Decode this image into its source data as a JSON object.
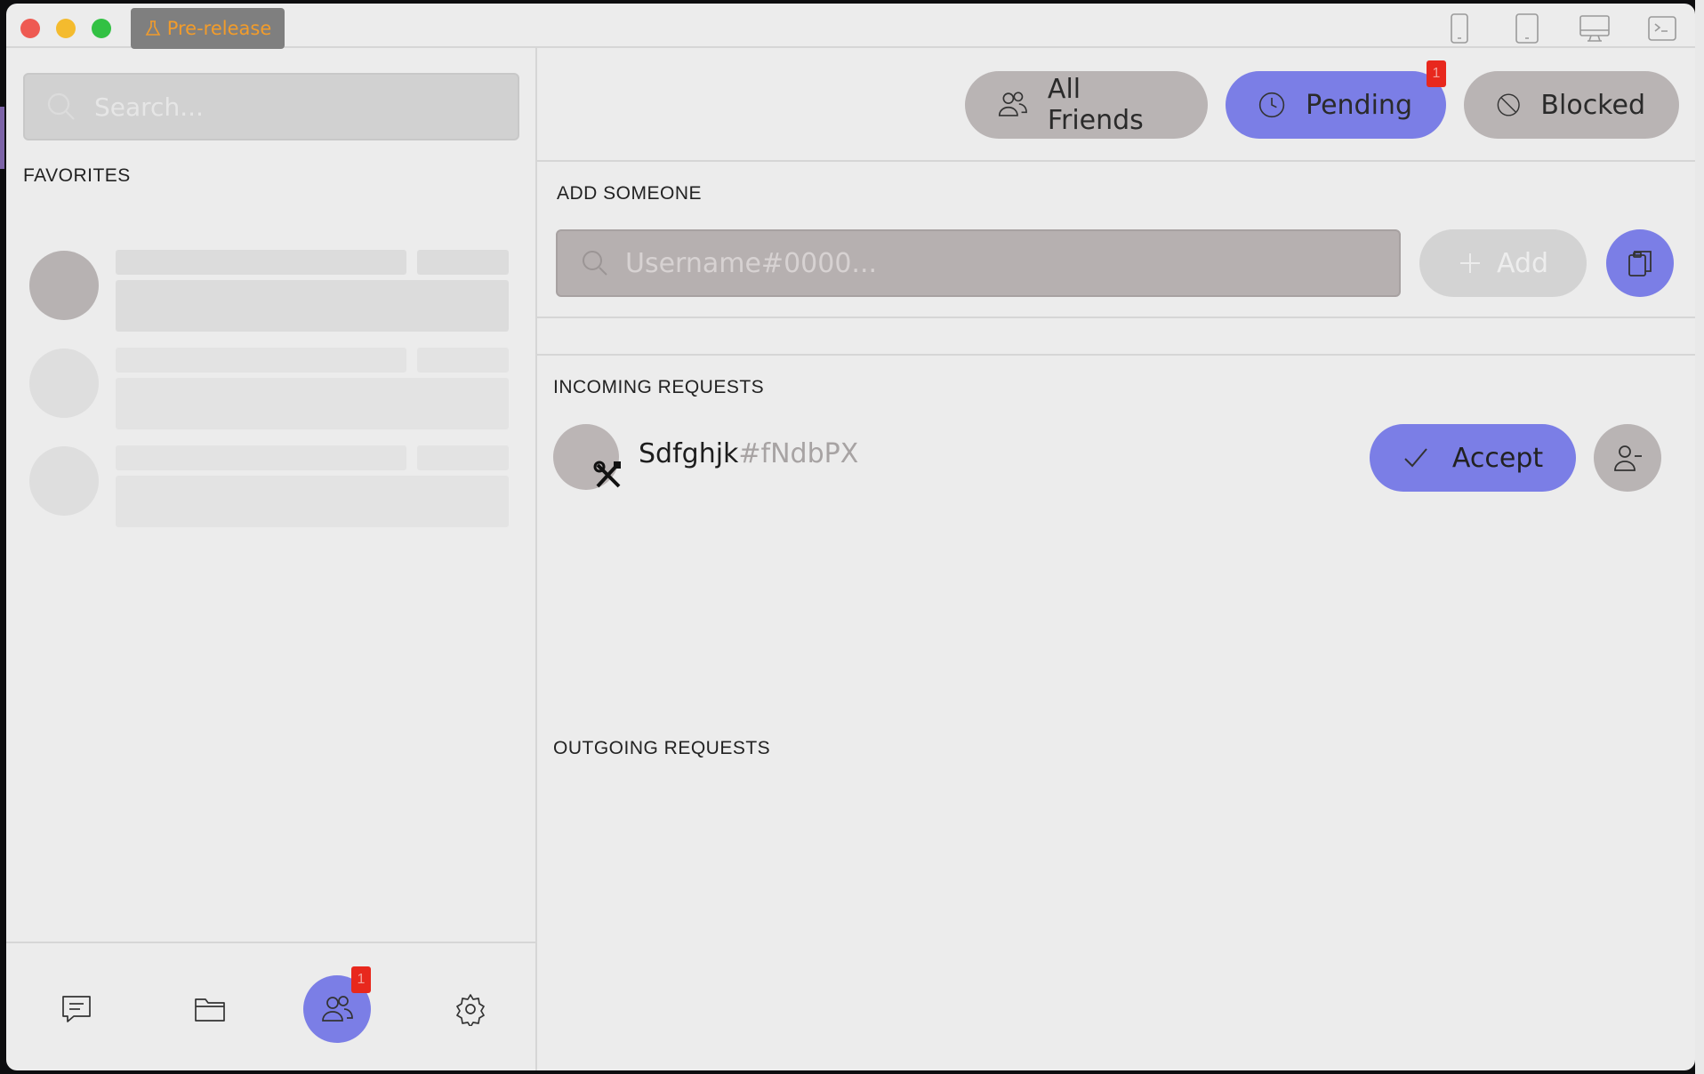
{
  "titlebar": {
    "badge_label": "Pre-release",
    "view_icons": [
      "mobile-icon",
      "tablet-icon",
      "desktop-icon",
      "terminal-icon"
    ]
  },
  "sidebar": {
    "search_placeholder": "Search...",
    "favorites_title": "FAVORITES",
    "nav": {
      "items": [
        "chat-icon",
        "folder-icon",
        "friends-icon",
        "settings-icon"
      ],
      "active": "friends-icon",
      "friends_badge": "1"
    }
  },
  "main": {
    "tabs": [
      {
        "label": "All Friends",
        "icon": "users-icon",
        "active": false
      },
      {
        "label": "Pending",
        "icon": "clock-icon",
        "active": true,
        "badge": "1"
      },
      {
        "label": "Blocked",
        "icon": "blocked-icon",
        "active": false
      }
    ],
    "add_someone": {
      "title": "ADD SOMEONE",
      "placeholder": "Username#0000...",
      "add_label": "Add"
    },
    "incoming": {
      "title": "INCOMING REQUESTS",
      "requests": [
        {
          "name": "Sdfghjk",
          "tag": "#fNdbPX",
          "accept_label": "Accept"
        }
      ]
    },
    "outgoing": {
      "title": "OUTGOING REQUESTS"
    }
  },
  "colors": {
    "accent": "#7b7ee6",
    "badge": "#e8281d",
    "prerelease_text": "#f29c2b"
  }
}
